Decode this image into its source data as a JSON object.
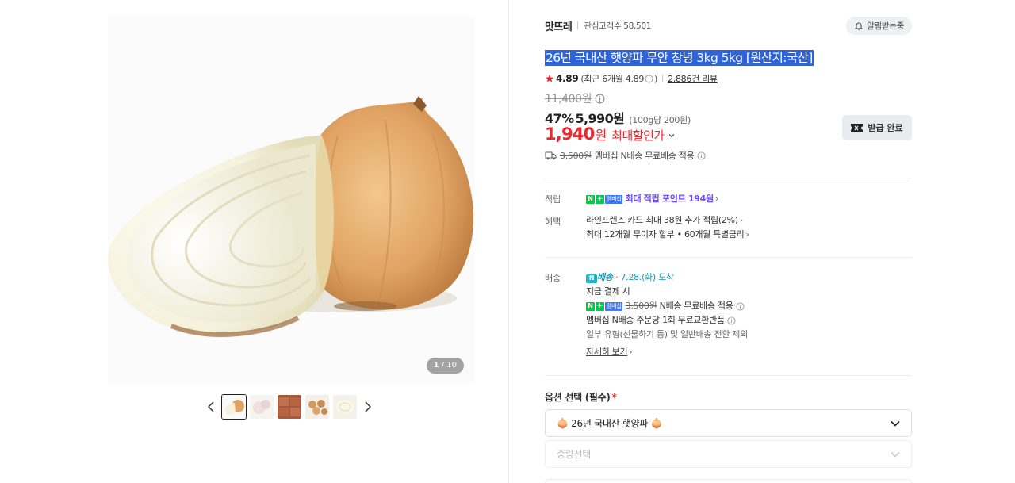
{
  "gallery": {
    "counter_current": "1",
    "counter_total": "/ 10",
    "thumbnails": [
      "onion-halved",
      "onions-peeled",
      "onion-sacks",
      "onion-pile",
      "onion-cut"
    ]
  },
  "store": {
    "name": "맛뜨레",
    "fans": "관심고객수 58,501",
    "alarm_label": "알림받는중"
  },
  "product": {
    "title": "26년 국내산 햇양파 무안 창녕 3kg 5kg [원산지:국산]",
    "rating": "4.89",
    "rating_detail": "(최근 6개월 4.89",
    "rating_detail_end": ")",
    "review_count": "2,886건 리뷰",
    "original_price": "11,400원",
    "discount_rate": "47%",
    "sale_price": "5,990원",
    "unit_price": "(100g당 200원)",
    "max_discount_price": "1,940",
    "max_discount_won": "원",
    "max_discount_label": "최대할인가",
    "coupon_button": "받급 완료",
    "shipping_fee_strike": "3,500원",
    "shipping_note": "멤버십 N배송 무료배송 적용"
  },
  "benefits": {
    "points_label": "적립",
    "points_badge": "멤버십",
    "points_text": "최대 적립 포인트 194원",
    "benefit_label": "혜택",
    "benefit_line1": "라인프렌즈 카드 최대 38원 추가 적립(2%)",
    "benefit_line2": "최대 12개월 무이자 할부 • 60개월 특별금리"
  },
  "delivery": {
    "label": "배송",
    "badge_text": "배송",
    "arrival": "7.28.(화) 도착",
    "line1": "지금 결제 시",
    "badge_member": "멤버십",
    "fee_strike": "3,500원",
    "line2_suffix": "N배송 무료배송 적용",
    "line3": "멤버십 N배송 주문당 1회 무료교환반품",
    "line4": "일부 유형(선물하기 등) 및 일반배송 전환 제외",
    "more_link": "자세히 보기"
  },
  "options": {
    "label": "옵션 선택 (필수)",
    "required_mark": "*",
    "select1_value": "🧅 26년 국내산 햇양파 🧅",
    "select2_placeholder": "중량선택"
  },
  "colors": {
    "accent_red": "#f0262d",
    "naver_green": "#00c73c",
    "highlight_blue": "#2e64d8",
    "point_purple": "#6b47ff"
  }
}
